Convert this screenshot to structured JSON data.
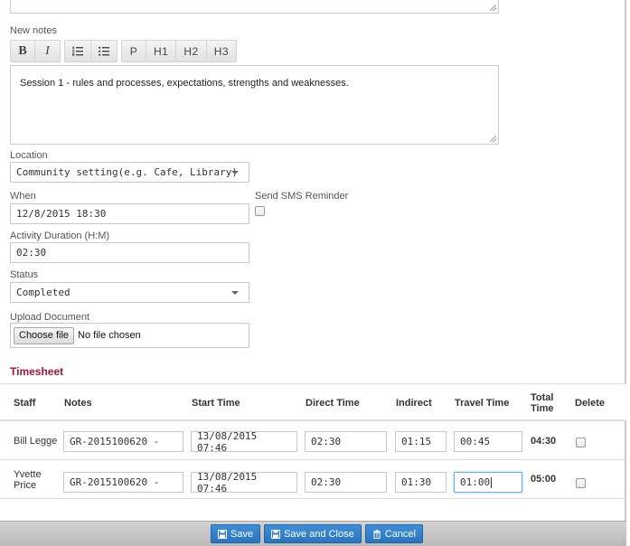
{
  "notes": {
    "label": "New notes",
    "toolbar": {
      "bold": "B",
      "italic": "I",
      "ordered_list_icon": "☰",
      "unordered_list_icon": "☷",
      "paragraph": "P",
      "h1": "H1",
      "h2": "H2",
      "h3": "H3"
    },
    "content": "Session 1 - rules and processes, expectations, strengths and weaknesses."
  },
  "location": {
    "label": "Location",
    "value": "Community setting(e.g. Cafe, Library)"
  },
  "when": {
    "label": "When",
    "value": "12/8/2015 18:30"
  },
  "sms": {
    "label": "Send SMS Reminder"
  },
  "duration": {
    "label": "Activity Duration (H:M)",
    "value": "02:30"
  },
  "status": {
    "label": "Status",
    "value": "Completed"
  },
  "upload": {
    "label": "Upload Document",
    "button": "Choose file",
    "status": "No file chosen"
  },
  "timesheet": {
    "title": "Timesheet",
    "headers": {
      "staff": "Staff",
      "notes": "Notes",
      "start": "Start Time",
      "direct": "Direct Time",
      "indirect": "Indirect",
      "travel": "Travel Time",
      "total_line1": "Total",
      "total_line2": "Time",
      "delete": "Delete"
    },
    "rows": [
      {
        "staff_line1": "Bill Legge",
        "staff_line2": "",
        "notes": "GR-2015100620 -",
        "start": "13/08/2015 07:46",
        "direct": "02:30",
        "indirect": "01:15",
        "travel": "00:45",
        "total": "04:30"
      },
      {
        "staff_line1": "Yvette",
        "staff_line2": "Price",
        "notes": "GR-2015100620 -",
        "start": "13/08/2015 07:46",
        "direct": "02:30",
        "indirect": "01:30",
        "travel": "01:00",
        "total": "05:00"
      }
    ]
  },
  "footer": {
    "save": "Save",
    "save_close": "Save and Close",
    "cancel": "Cancel",
    "save_icon": "floppy-disk-icon",
    "cancel_icon": "trash-icon",
    "accent": "#2a74bd"
  }
}
